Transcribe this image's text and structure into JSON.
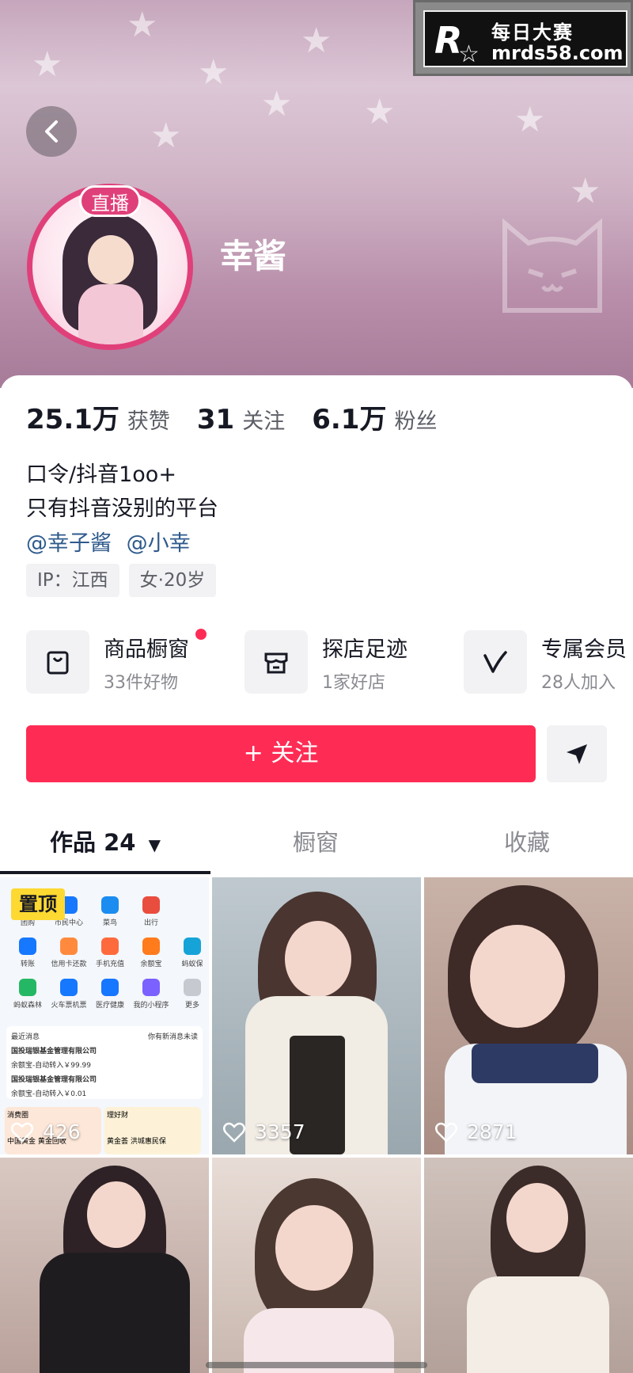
{
  "watermark": {
    "logo_letter": "R",
    "cn_text": "每日大赛",
    "url": "mrds58.com"
  },
  "profile": {
    "name": "幸酱",
    "live_badge": "直播"
  },
  "stats": [
    {
      "value": "25.1万",
      "label": "获赞"
    },
    {
      "value": "31",
      "label": "关注"
    },
    {
      "value": "6.1万",
      "label": "粉丝"
    }
  ],
  "bio": {
    "line1": "口令/抖音1oo+",
    "line2": "只有抖音没别的平台"
  },
  "mentions": [
    "@幸子酱",
    "@小幸"
  ],
  "tags": [
    "IP：江西",
    "女·20岁"
  ],
  "services": [
    {
      "title": "商品橱窗",
      "sub": "33件好物",
      "icon": "bag-icon",
      "has_dot": true
    },
    {
      "title": "探店足迹",
      "sub": "1家好店",
      "icon": "store-icon",
      "has_dot": false
    },
    {
      "title": "专属会员",
      "sub": "28人加入",
      "icon": "vip-icon",
      "has_dot": false
    }
  ],
  "actions": {
    "follow_label": "+ 关注"
  },
  "tabs": {
    "works": "作品 24",
    "showcase": "橱窗",
    "favorites": "收藏"
  },
  "videos": [
    {
      "likes": "426",
      "pinned_label": "置顶"
    },
    {
      "likes": "3357"
    },
    {
      "likes": "2871"
    },
    {
      "likes": ""
    },
    {
      "likes": ""
    },
    {
      "likes": ""
    }
  ],
  "app_screenshot": {
    "row1": [
      "团购",
      "市民中心",
      "菜鸟",
      "出行"
    ],
    "row2": [
      "转账",
      "信用卡还款",
      "手机充值",
      "余额宝",
      "蚂蚁保"
    ],
    "row3": [
      "蚂蚁森林",
      "火车票机票",
      "医疗健康",
      "我的小程序",
      "更多"
    ],
    "msg_header": "最近消息",
    "msg_unread": "你有新消息未读",
    "msg1_title": "国投瑞银基金管理有限公司",
    "msg1_body": "余额宝-自动转入￥99.99",
    "msg2_title": "国投瑞银基金管理有限公司",
    "msg2_body": "余额宝-自动转入￥0.01",
    "card1": "消费圈",
    "card2": "理好财",
    "card1_sub": "中国黄金",
    "card2_sub": "黄金回收",
    "card3_sub": "黄金荟",
    "card4_sub": "洪城惠民保"
  },
  "colors": {
    "accent": "#fe2c55",
    "live": "#e0407a",
    "mention": "#2e5a8c",
    "pin": "#fdd932"
  }
}
